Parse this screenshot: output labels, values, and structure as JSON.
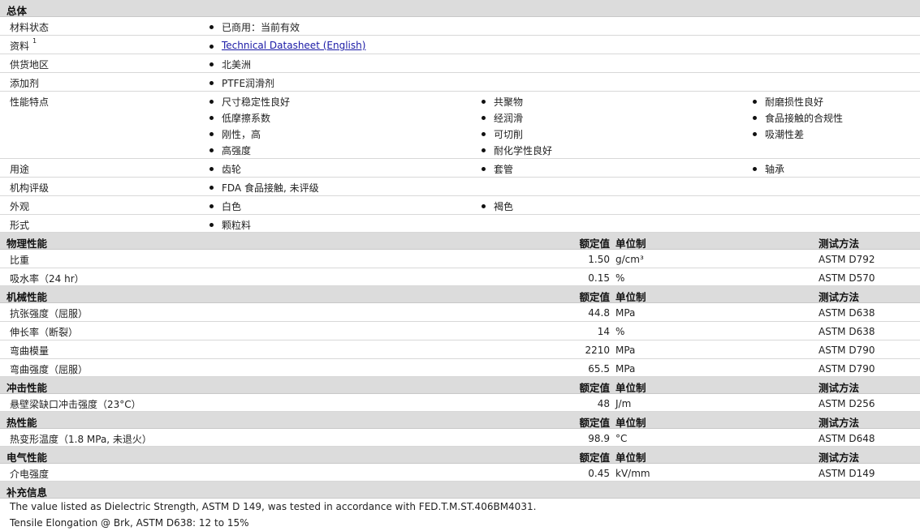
{
  "general": {
    "title": "总体",
    "rows": {
      "status": {
        "label": "材料状态",
        "value": "已商用：当前有效"
      },
      "docs": {
        "label": "资料",
        "sup": "1",
        "link": "Technical Datasheet (English)"
      },
      "region": {
        "label": "供货地区",
        "value": "北美洲"
      },
      "additive": {
        "label": "添加剂",
        "value": "PTFE润滑剂"
      },
      "features": {
        "label": "性能特点",
        "col1": [
          "尺寸稳定性良好",
          "低摩擦系数",
          "刚性，高",
          "高强度"
        ],
        "col2": [
          "共聚物",
          "经润滑",
          "可切削",
          "耐化学性良好"
        ],
        "col3": [
          "耐磨损性良好",
          "食品接触的合规性",
          "吸潮性差"
        ]
      },
      "uses": {
        "label": "用途",
        "col1": "齿轮",
        "col2": "套管",
        "col3": "轴承"
      },
      "agency": {
        "label": "机构评级",
        "value": "FDA 食品接触, 未评级"
      },
      "appearance": {
        "label": "外观",
        "col1": "白色",
        "col2": "褐色"
      },
      "form": {
        "label": "形式",
        "value": "颗粒料"
      }
    }
  },
  "headers": {
    "value": "额定值",
    "unit": "单位制",
    "method": "测试方法"
  },
  "physical": {
    "title": "物理性能",
    "rows": [
      {
        "label": "比重",
        "value": "1.50",
        "unit": "g/cm³",
        "method": "ASTM D792"
      },
      {
        "label": "吸水率（24 hr）",
        "value": "0.15",
        "unit": "%",
        "method": "ASTM D570"
      }
    ]
  },
  "mechanical": {
    "title": "机械性能",
    "rows": [
      {
        "label": "抗张强度（屈服）",
        "value": "44.8",
        "unit": "MPa",
        "method": "ASTM D638"
      },
      {
        "label": "伸长率（断裂）",
        "value": "14",
        "unit": "%",
        "method": "ASTM D638"
      },
      {
        "label": "弯曲模量",
        "value": "2210",
        "unit": "MPa",
        "method": "ASTM D790"
      },
      {
        "label": "弯曲强度（屈服）",
        "value": "65.5",
        "unit": "MPa",
        "method": "ASTM D790"
      }
    ]
  },
  "impact": {
    "title": "冲击性能",
    "rows": [
      {
        "label": "悬壁梁缺口冲击强度（23°C）",
        "value": "48",
        "unit": "J/m",
        "method": "ASTM D256"
      }
    ]
  },
  "thermal": {
    "title": "热性能",
    "rows": [
      {
        "label": "热变形温度（1.8 MPa, 未退火）",
        "value": "98.9",
        "unit": "°C",
        "method": "ASTM D648"
      }
    ]
  },
  "electrical": {
    "title": "电气性能",
    "rows": [
      {
        "label": "介电强度",
        "value": "0.45",
        "unit": "kV/mm",
        "method": "ASTM D149"
      }
    ]
  },
  "supplementary": {
    "title": "补充信息",
    "notes": [
      "The value listed as Dielectric Strength, ASTM D 149, was tested in accordance with FED.T.M.ST.406BM4031.",
      "Tensile Elongation @ Brk, ASTM D638: 12 to 15%"
    ]
  }
}
